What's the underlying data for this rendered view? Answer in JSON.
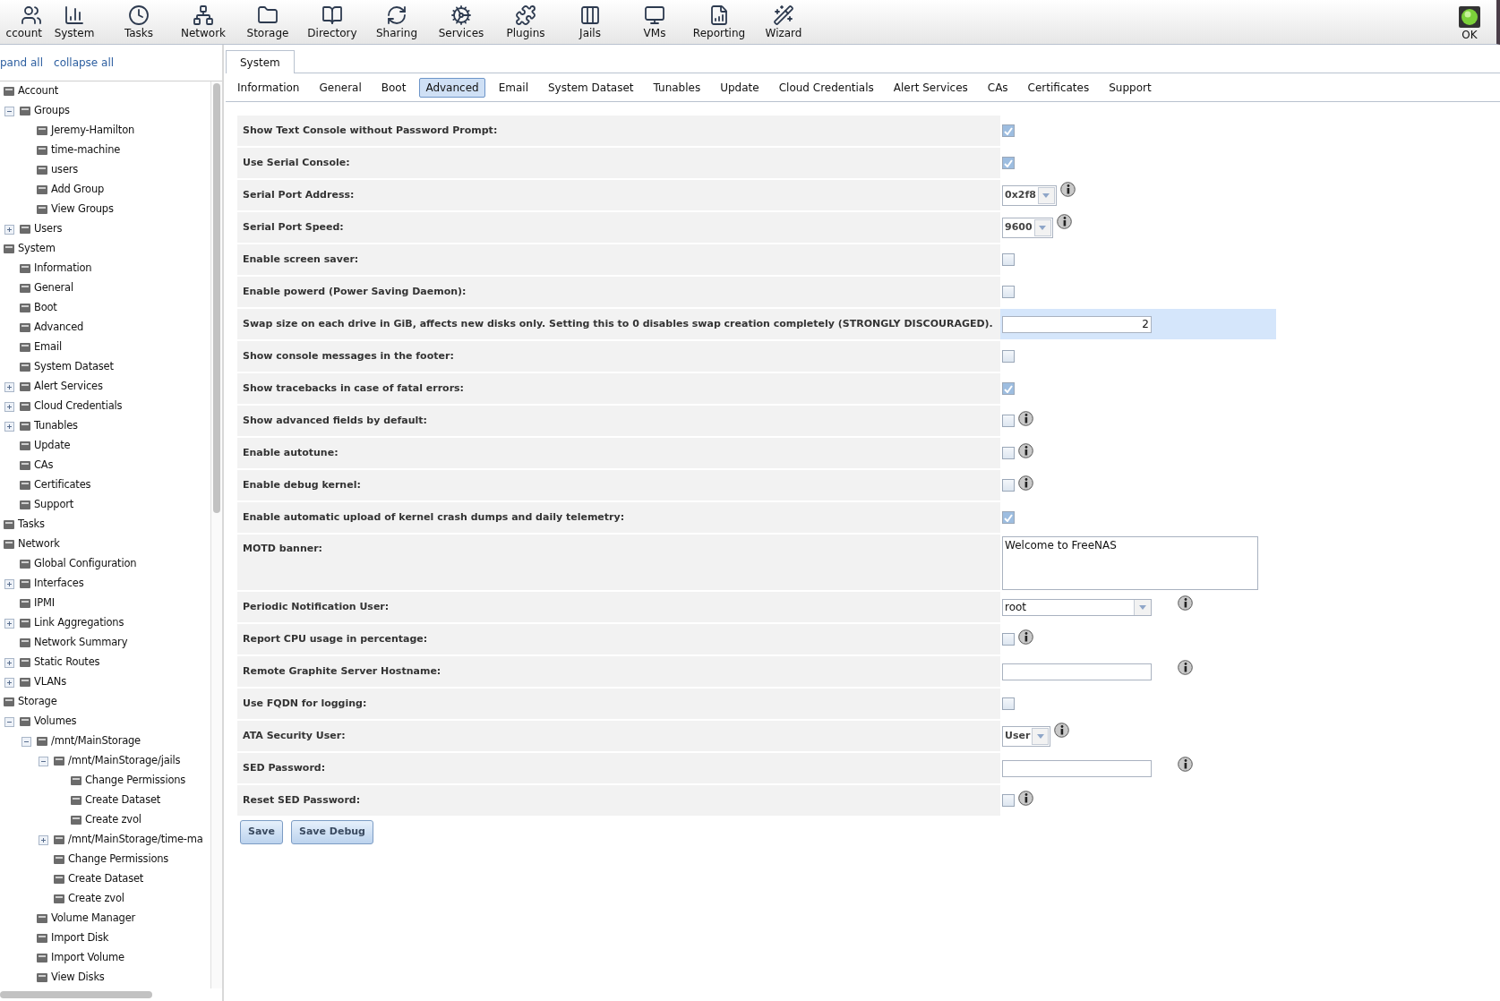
{
  "toolbar": [
    {
      "label": "ccount"
    },
    {
      "label": "System"
    },
    {
      "label": "Tasks"
    },
    {
      "label": "Network"
    },
    {
      "label": "Storage"
    },
    {
      "label": "Directory"
    },
    {
      "label": "Sharing"
    },
    {
      "label": "Services"
    },
    {
      "label": "Plugins"
    },
    {
      "label": "Jails"
    },
    {
      "label": "VMs"
    },
    {
      "label": "Reporting"
    },
    {
      "label": "Wizard"
    }
  ],
  "status": {
    "label": "OK"
  },
  "sidebar": {
    "links": [
      "pand all",
      "collapse all"
    ],
    "tree": [
      {
        "label": "Account",
        "children": [
          {
            "label": "Groups",
            "expanded": true,
            "children": [
              {
                "label": "Jeremy-Hamilton"
              },
              {
                "label": "time-machine"
              },
              {
                "label": "users"
              },
              {
                "label": "Add Group"
              },
              {
                "label": "View Groups"
              }
            ]
          },
          {
            "label": "Users",
            "expanded": false
          }
        ]
      },
      {
        "label": "System",
        "children": [
          {
            "label": "Information"
          },
          {
            "label": "General"
          },
          {
            "label": "Boot"
          },
          {
            "label": "Advanced"
          },
          {
            "label": "Email"
          },
          {
            "label": "System Dataset"
          },
          {
            "label": "Alert Services",
            "expanded": false
          },
          {
            "label": "Cloud Credentials",
            "expanded": false
          },
          {
            "label": "Tunables",
            "expanded": false
          },
          {
            "label": "Update"
          },
          {
            "label": "CAs"
          },
          {
            "label": "Certificates"
          },
          {
            "label": "Support"
          }
        ]
      },
      {
        "label": "Tasks"
      },
      {
        "label": "Network",
        "children": [
          {
            "label": "Global Configuration"
          },
          {
            "label": "Interfaces",
            "expanded": false
          },
          {
            "label": "IPMI"
          },
          {
            "label": "Link Aggregations",
            "expanded": false
          },
          {
            "label": "Network Summary"
          },
          {
            "label": "Static Routes",
            "expanded": false
          },
          {
            "label": "VLANs",
            "expanded": false
          }
        ]
      },
      {
        "label": "Storage",
        "children": [
          {
            "label": "Volumes",
            "expanded": true,
            "children": [
              {
                "label": "/mnt/MainStorage",
                "expanded": true,
                "children": [
                  {
                    "label": "/mnt/MainStorage/jails",
                    "expanded": true,
                    "children": [
                      {
                        "label": "Change Permissions"
                      },
                      {
                        "label": "Create Dataset"
                      },
                      {
                        "label": "Create zvol"
                      }
                    ]
                  },
                  {
                    "label": "/mnt/MainStorage/time-ma",
                    "expanded": false
                  },
                  {
                    "label": "Change Permissions"
                  },
                  {
                    "label": "Create Dataset"
                  },
                  {
                    "label": "Create zvol"
                  }
                ]
              },
              {
                "label": "Volume Manager"
              },
              {
                "label": "Import Disk"
              },
              {
                "label": "Import Volume"
              },
              {
                "label": "View Disks"
              }
            ]
          }
        ]
      }
    ]
  },
  "main_tab": {
    "label": "System",
    "selected": true
  },
  "subtabs": [
    {
      "label": "Information",
      "selected": false
    },
    {
      "label": "General",
      "selected": false
    },
    {
      "label": "Boot",
      "selected": false
    },
    {
      "label": "Advanced",
      "selected": true
    },
    {
      "label": "Email",
      "selected": false
    },
    {
      "label": "System Dataset",
      "selected": false
    },
    {
      "label": "Tunables",
      "selected": false
    },
    {
      "label": "Update",
      "selected": false
    },
    {
      "label": "Cloud Credentials",
      "selected": false
    },
    {
      "label": "Alert Services",
      "selected": false
    },
    {
      "label": "CAs",
      "selected": false
    },
    {
      "label": "Certificates",
      "selected": false
    },
    {
      "label": "Support",
      "selected": false
    }
  ],
  "form": [
    {
      "label": "Show Text Console without Password Prompt:",
      "kind": "checkbox",
      "checked": true,
      "info": false,
      "highlighted": false
    },
    {
      "label": "Use Serial Console:",
      "kind": "checkbox",
      "checked": true,
      "info": false,
      "highlighted": false
    },
    {
      "label": "Serial Port Address:",
      "kind": "select",
      "value": "0x2f8",
      "info": true,
      "highlighted": false
    },
    {
      "label": "Serial Port Speed:",
      "kind": "select",
      "value": "9600",
      "info": true,
      "highlighted": false
    },
    {
      "label": "Enable screen saver:",
      "kind": "checkbox",
      "checked": false,
      "info": false,
      "highlighted": false
    },
    {
      "label": "Enable powerd (Power Saving Daemon):",
      "kind": "checkbox",
      "checked": false,
      "info": false,
      "highlighted": false
    },
    {
      "label": "Swap size on each drive in GiB, affects new disks only. Setting this to 0 disables swap creation completely (STRONGLY DISCOURAGED).",
      "kind": "number",
      "value": "2",
      "info": false,
      "highlighted": true
    },
    {
      "label": "Show console messages in the footer:",
      "kind": "checkbox",
      "checked": false,
      "info": false,
      "highlighted": false
    },
    {
      "label": "Show tracebacks in case of fatal errors:",
      "kind": "checkbox",
      "checked": true,
      "info": false,
      "highlighted": false
    },
    {
      "label": "Show advanced fields by default:",
      "kind": "checkbox",
      "checked": false,
      "info": true,
      "highlighted": false
    },
    {
      "label": "Enable autotune:",
      "kind": "checkbox",
      "checked": false,
      "info": true,
      "highlighted": false
    },
    {
      "label": "Enable debug kernel:",
      "kind": "checkbox",
      "checked": false,
      "info": true,
      "highlighted": false
    },
    {
      "label": "Enable automatic upload of kernel crash dumps and daily telemetry:",
      "kind": "checkbox",
      "checked": true,
      "info": false,
      "highlighted": false
    },
    {
      "label": "MOTD banner:",
      "kind": "textarea",
      "value": "Welcome to FreeNAS",
      "info": false,
      "highlighted": false
    },
    {
      "label": "Periodic Notification User:",
      "kind": "dropdown",
      "value": "root",
      "info": true,
      "highlighted": false
    },
    {
      "label": "Report CPU usage in percentage:",
      "kind": "checkbox",
      "checked": false,
      "info": true,
      "highlighted": false
    },
    {
      "label": "Remote Graphite Server Hostname:",
      "kind": "text",
      "info": true,
      "highlighted": false
    },
    {
      "label": "Use FQDN for logging:",
      "kind": "checkbox",
      "checked": false,
      "info": false,
      "highlighted": false
    },
    {
      "label": "ATA Security User:",
      "kind": "select",
      "value": "User",
      "info": true,
      "highlighted": false
    },
    {
      "label": "SED Password:",
      "kind": "text",
      "info": true,
      "highlighted": false
    },
    {
      "label": "Reset SED Password:",
      "kind": "checkbox",
      "checked": false,
      "info": true,
      "highlighted": false
    }
  ],
  "buttons": [
    "Save",
    "Save Debug"
  ]
}
